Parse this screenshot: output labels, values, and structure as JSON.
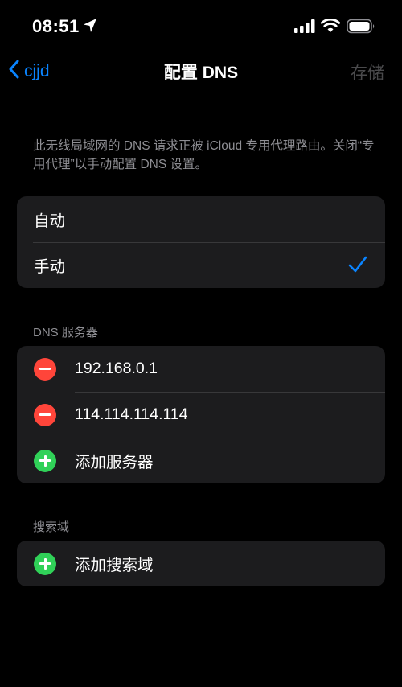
{
  "status_bar": {
    "time": "08:51"
  },
  "nav": {
    "back_label": "cjjd",
    "title": "配置 DNS",
    "save_label": "存储"
  },
  "note": "此无线局域网的 DNS 请求正被 iCloud 专用代理路由。关闭“专用代理”以手动配置 DNS 设置。",
  "mode": {
    "options": [
      {
        "label": "自动",
        "selected": false
      },
      {
        "label": "手动",
        "selected": true
      }
    ]
  },
  "dns_servers": {
    "header": "DNS 服务器",
    "servers": [
      "192.168.0.1",
      "114.114.114.114"
    ],
    "add_label": "添加服务器"
  },
  "search_domains": {
    "header": "搜索域",
    "add_label": "添加搜索域"
  },
  "colors": {
    "accent": "#0a84ff",
    "delete": "#ff453a",
    "add": "#30d158",
    "cell_bg": "#1c1c1e",
    "disabled": "#4a4a4c"
  }
}
